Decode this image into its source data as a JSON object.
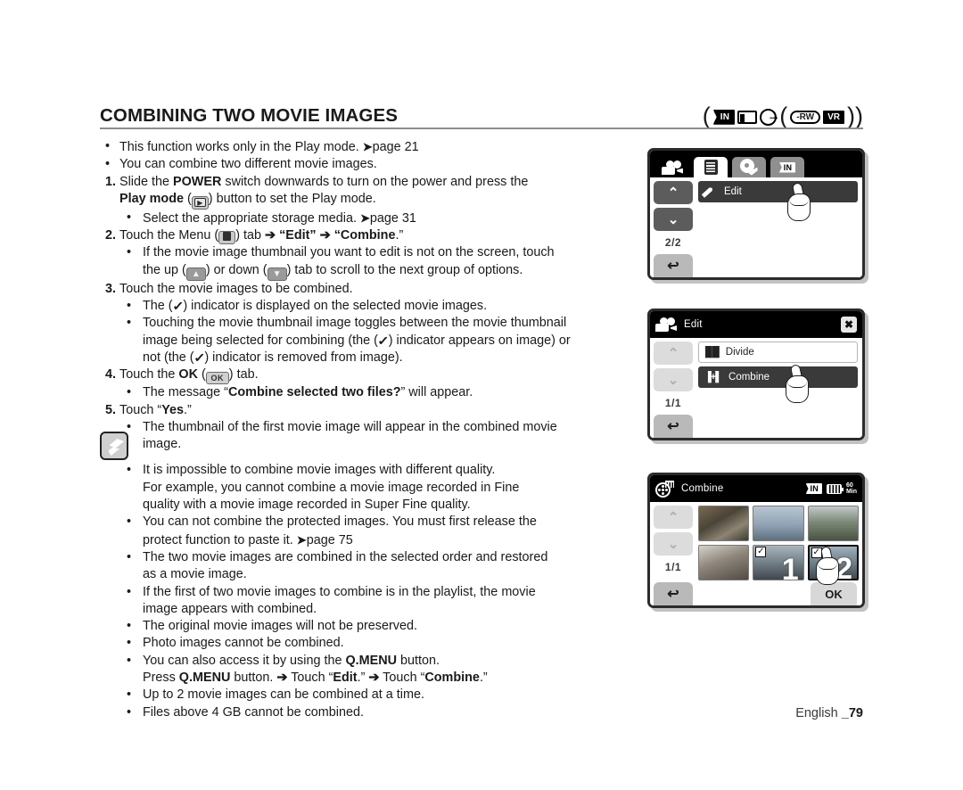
{
  "header": {
    "title": "COMBINING TWO MOVIE IMAGES",
    "media_badges": {
      "open_paren": "(",
      "in": "IN",
      "card": "card-icon",
      "disc": "disc-icon",
      "inner_open_paren": "(",
      "rw": "-RW",
      "vr": "VR",
      "close_parens": "))"
    }
  },
  "body": {
    "b1": "This function works only in the Play mode.",
    "b1_page": "page 21",
    "b2": "You can combine two different movie images.",
    "s1_num": "1.",
    "s1_a": "Slide the ",
    "s1_power": "POWER",
    "s1_b": " switch downwards to turn on the power and press the",
    "s1_playmode": "Play mode",
    "s1_c": ") button to set the Play mode.",
    "s1_sub": "Select the appropriate storage media.",
    "s1_sub_page": "page 31",
    "s2_num": "2.",
    "s2_a": "Touch the Menu (",
    "s2_b": ") tab",
    "s2_arrow1": "➔",
    "s2_edit": "“Edit”",
    "s2_arrow2": "➔",
    "s2_combine": "“Combine",
    "s2_end": ".”",
    "s2_sub1": "If the movie image thumbnail you want to edit is not on the screen, touch",
    "s2_sub1b_a": "the up (",
    "s2_sub1b_b": ") or down (",
    "s2_sub1b_c": ") tab to scroll to the next group of options.",
    "s3_num": "3.",
    "s3": "Touch the movie images to be combined.",
    "s3_sub1_a": "The (",
    "s3_sub1_b": ") indicator is displayed on the selected movie images.",
    "s3_sub2_a": "Touching the movie thumbnail image toggles between the movie thumbnail",
    "s3_sub2_b": "image being selected for combining (the (",
    "s3_sub2_c": ") indicator appears on image) or",
    "s3_sub2_d": "not (the (",
    "s3_sub2_e": ") indicator is removed from image).",
    "s4_num": "4.",
    "s4_a": "Touch the ",
    "s4_ok": "OK",
    "s4_b": " (",
    "s4_c": ") tab.",
    "s4_sub_a": "The message “",
    "s4_sub_msg": "Combine selected two files?",
    "s4_sub_b": "” will appear.",
    "s5_num": "5.",
    "s5_a": "Touch “",
    "s5_yes": "Yes",
    "s5_b": ".”",
    "s5_sub_a": "The thumbnail of the first movie image will appear in the combined movie",
    "s5_sub_b": "image."
  },
  "notes": [
    {
      "lines": [
        "It is impossible to combine movie images with different quality.",
        "For example, you cannot combine a movie image recorded in Fine",
        "quality with a movie image recorded in Super Fine quality."
      ]
    },
    {
      "lines": [
        "You can not combine the protected images. You must first release the",
        "protect function to paste it."
      ],
      "page_ref": "page 75"
    },
    {
      "lines": [
        "The two movie images are combined in the selected order and restored",
        "as a movie image."
      ]
    },
    {
      "lines": [
        "If the first of two movie images to combine is in the playlist, the movie",
        "image appears with combined."
      ]
    },
    {
      "lines": [
        "The original movie images will not be preserved."
      ]
    },
    {
      "lines": [
        "Photo images cannot be combined."
      ]
    },
    {
      "lines": [
        "You can  also access it by using the Q.MENU button."
      ],
      "rich": {
        "a": "You can  also access it by using the ",
        "qmenu": "Q.MENU",
        "b": " button."
      },
      "second_line": {
        "a": "Press ",
        "qmenu": "Q.MENU",
        "b": " button. ",
        "arrow1": "➔",
        "c": " Touch “",
        "edit": "Edit",
        "d": ".” ",
        "arrow2": "➔",
        "e": " Touch “",
        "combine": "Combine",
        "f": ".”"
      }
    },
    {
      "lines": [
        "Up to 2 movie images can be combined at a time."
      ]
    },
    {
      "lines": [
        "Files above 4 GB cannot be combined."
      ]
    }
  ],
  "screens": {
    "screen1": {
      "tabs": [
        {
          "icon": "camcorder-icon",
          "state": "plain"
        },
        {
          "icon": "menu-list-icon",
          "state": "active"
        },
        {
          "icon": "settings-gear-icon",
          "state": "inactive"
        },
        {
          "icon": "storage-in-icon",
          "label": "IN",
          "state": "inactive"
        }
      ],
      "up_label": "⌃",
      "down_label": "⌄",
      "page_indicator": "2/2",
      "back_label": "↩",
      "items": [
        {
          "icon": "pencil-icon",
          "label": "Edit",
          "selected": true
        }
      ]
    },
    "screen2": {
      "title": "Edit",
      "title_icon": "camcorder-icon",
      "close_label": "✖",
      "up_label": "⌃",
      "down_label": "⌄",
      "page_indicator": "1/1",
      "back_label": "↩",
      "items": [
        {
          "icon": "divide-icon",
          "icon_text": "█ █",
          "label": "Divide",
          "selected": false
        },
        {
          "icon": "combine-icon",
          "icon_text": "▐+▌",
          "label": "Combine",
          "selected": true
        }
      ]
    },
    "screen3": {
      "title": "Combine",
      "title_icon": "film-reel-icon",
      "status": {
        "storage": "IN",
        "battery": "battery-icon",
        "time_top": "60",
        "time_bottom": "Min"
      },
      "up_label": "⌃",
      "down_label": "⌄",
      "page_indicator": "1/1",
      "back_label": "↩",
      "ok_label": "OK",
      "thumbnails": [
        {
          "id": 1,
          "selected": false,
          "badge": "",
          "check": false
        },
        {
          "id": 2,
          "selected": false,
          "badge": "",
          "check": false
        },
        {
          "id": 3,
          "selected": false,
          "badge": "",
          "check": false
        },
        {
          "id": 4,
          "selected": false,
          "badge": "",
          "check": false
        },
        {
          "id": 5,
          "selected": false,
          "badge": "1",
          "check": true
        },
        {
          "id": 6,
          "selected": true,
          "badge": "2",
          "check": true
        }
      ],
      "check_glyph": "✓"
    }
  },
  "footer": {
    "language": "English ",
    "page_number": "79",
    "underscore": "_"
  }
}
